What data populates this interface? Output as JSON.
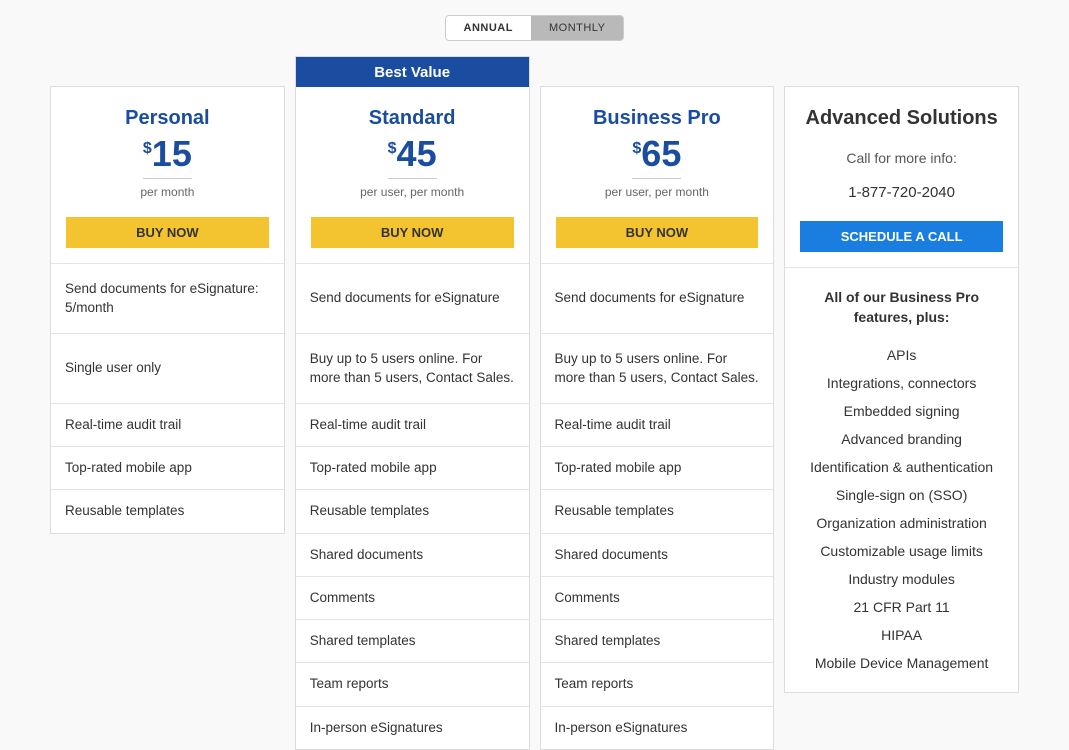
{
  "toggle": {
    "annual": "ANNUAL",
    "monthly": "MONTHLY"
  },
  "plans": [
    {
      "name": "Personal",
      "price": "15",
      "currency": "$",
      "period": "per month",
      "cta": "BUY NOW",
      "features": [
        "Send documents for eSignature: 5/month",
        "Single user only",
        "Real-time audit trail",
        "Top-rated mobile app",
        "Reusable templates"
      ]
    },
    {
      "name": "Standard",
      "badge": "Best Value",
      "price": "45",
      "currency": "$",
      "period": "per user, per month",
      "cta": "BUY NOW",
      "features": [
        "Send documents for eSignature",
        "Buy up to 5 users online. For more than 5 users, Contact Sales.",
        "Real-time audit trail",
        "Top-rated mobile app",
        "Reusable templates",
        "Shared documents",
        "Comments",
        "Shared templates",
        "Team reports",
        "In-person eSignatures"
      ]
    },
    {
      "name": "Business Pro",
      "price": "65",
      "currency": "$",
      "period": "per user, per month",
      "cta": "BUY NOW",
      "features": [
        "Send documents for eSignature",
        "Buy up to 5 users online. For more than 5 users, Contact Sales.",
        "Real-time audit trail",
        "Top-rated mobile app",
        "Reusable templates",
        "Shared documents",
        "Comments",
        "Shared templates",
        "Team reports",
        "In-person eSignatures"
      ]
    }
  ],
  "advanced": {
    "name": "Advanced Solutions",
    "call_info": "Call for more info:",
    "phone": "1-877-720-2040",
    "cta": "SCHEDULE A CALL",
    "lead": "All of our Business Pro features, plus:",
    "features": [
      "APIs",
      "Integrations, connectors",
      "Embedded signing",
      "Advanced branding",
      "Identification & authentication",
      "Single-sign on (SSO)",
      "Organization administration",
      "Customizable usage limits",
      "Industry modules",
      "21 CFR Part 11",
      "HIPAA",
      "Mobile Device Management"
    ]
  }
}
